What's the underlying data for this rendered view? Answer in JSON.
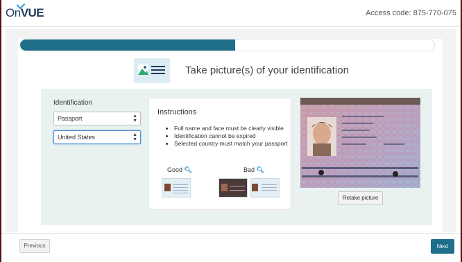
{
  "header": {
    "logo_text_on": "On",
    "logo_text_vue": "VUE",
    "access_code": "Access code: 875-770-075"
  },
  "progress": {
    "fraction": 0.52
  },
  "step": {
    "title": "Take picture(s) of your identification"
  },
  "identification": {
    "label": "Identification",
    "type_selected": "Passport",
    "country_selected": "United States"
  },
  "instructions": {
    "title": "Instructions",
    "items": [
      "Full name and face must be clearly visible",
      "Identification cannot be expired",
      "Selected country must match your passport"
    ],
    "good_label": "Good",
    "bad_label": "Bad"
  },
  "captured": {
    "retake_label": "Retake picture"
  },
  "footer": {
    "previous_label": "Previous",
    "next_label": "Next"
  },
  "colors": {
    "accent": "#1f6f8b",
    "panel": "#e9f2f1",
    "link": "#2f8fd1"
  }
}
